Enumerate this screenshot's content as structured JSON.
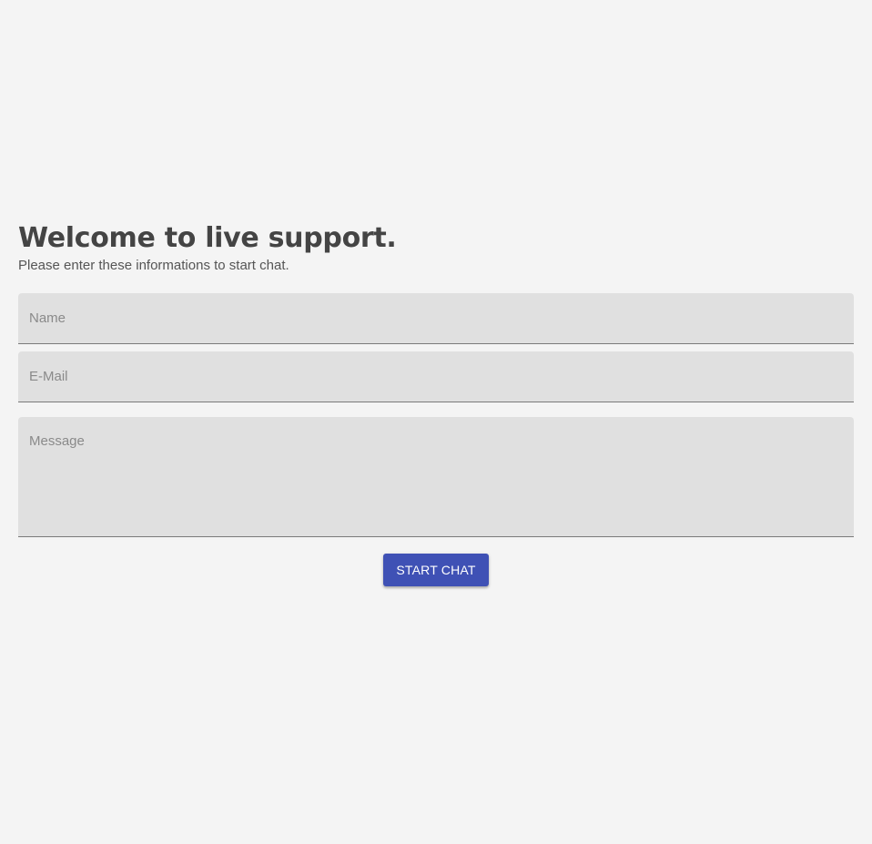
{
  "form": {
    "title": "Welcome to live support.",
    "subtitle": "Please enter these informations to start chat.",
    "fields": {
      "name": {
        "placeholder": "Name",
        "value": ""
      },
      "email": {
        "placeholder": "E-Mail",
        "value": ""
      },
      "message": {
        "placeholder": "Message",
        "value": ""
      }
    },
    "submit_label": "START CHAT"
  },
  "colors": {
    "background": "#f4f4f4",
    "field_background": "#e0e0e0",
    "accent": "#3f51b5",
    "title_text": "#444444"
  }
}
